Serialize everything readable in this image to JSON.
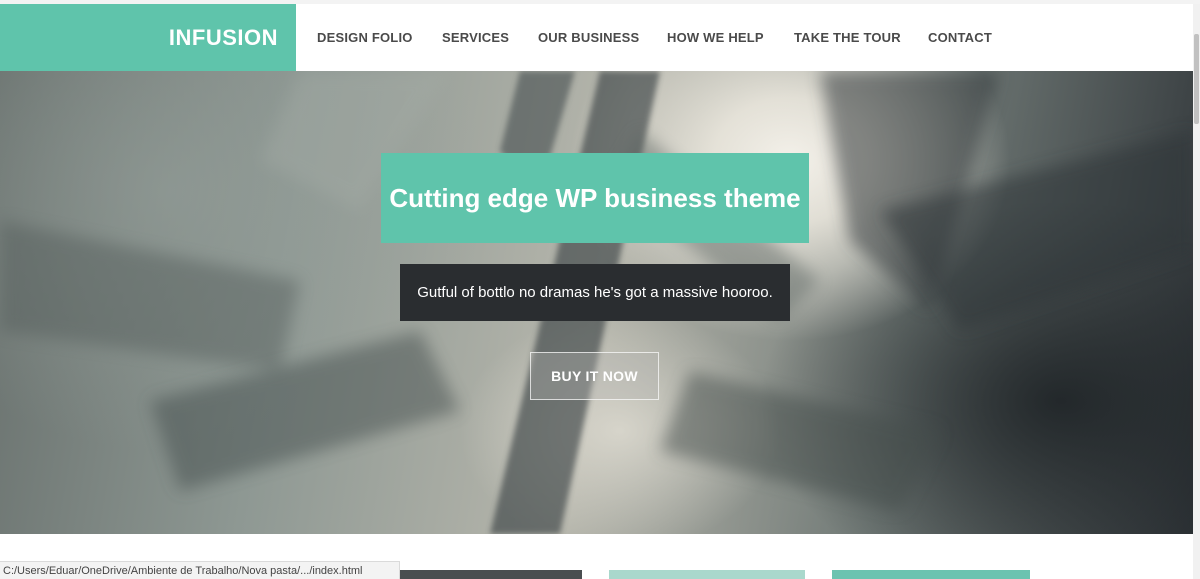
{
  "brand": {
    "name": "INFUSION",
    "accent": "#5fc4ab"
  },
  "nav": {
    "items": [
      {
        "label": "DESIGN FOLIO"
      },
      {
        "label": "SERVICES"
      },
      {
        "label": "OUR BUSINESS"
      },
      {
        "label": "HOW WE HELP"
      },
      {
        "label": "TAKE THE TOUR"
      },
      {
        "label": "CONTACT"
      }
    ]
  },
  "hero": {
    "headline": "Cutting edge WP business theme",
    "subheadline": "Gutful of bottlo no dramas he's got a massive hooroo.",
    "cta_label": "BUY IT NOW",
    "caption_bg": "#2a2d30"
  },
  "status_bar": {
    "url": "C:/Users/Eduar/OneDrive/Ambiente de Trabalho/Nova pasta/.../index.html"
  }
}
